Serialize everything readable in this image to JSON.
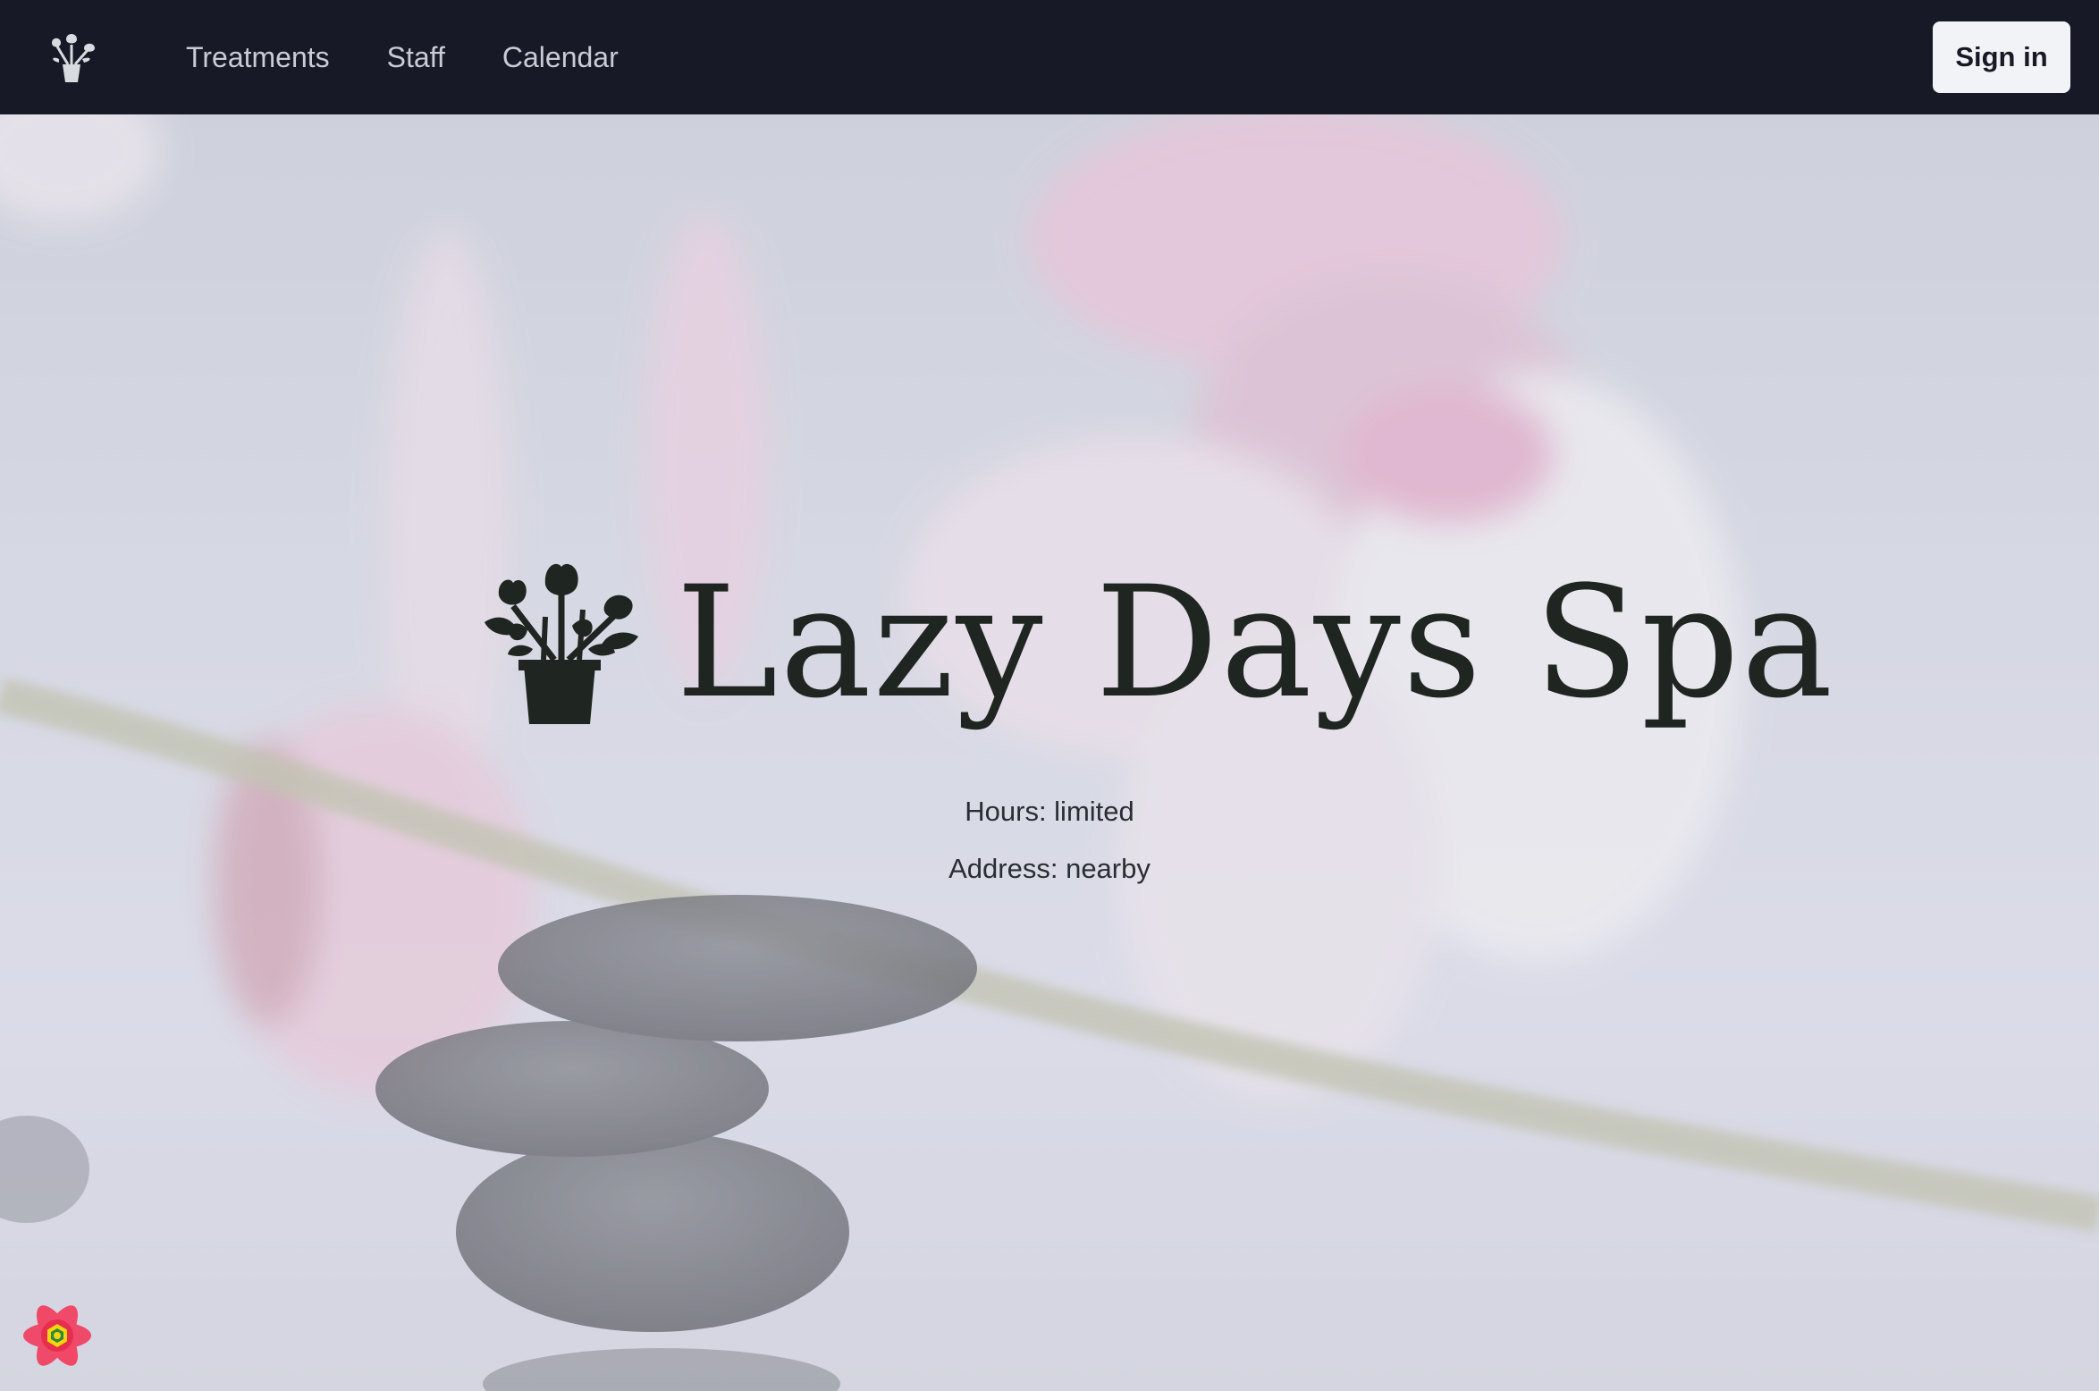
{
  "nav": {
    "logo_icon": "flower-pot-icon",
    "links": [
      "Treatments",
      "Staff",
      "Calendar"
    ],
    "signin_label": "Sign in"
  },
  "hero": {
    "logo_icon": "flower-pot-icon",
    "title": "Lazy Days Spa",
    "hours": "Hours: limited",
    "address": "Address: nearby",
    "background": "orchid-and-stacked-stones-photo"
  },
  "devtools": {
    "icon": "react-query-devtools-icon"
  },
  "colors": {
    "navbar": "#171a26",
    "nav_link": "#c9ccd4",
    "title": "#1f2520",
    "button_bg": "#f1f3f6"
  }
}
